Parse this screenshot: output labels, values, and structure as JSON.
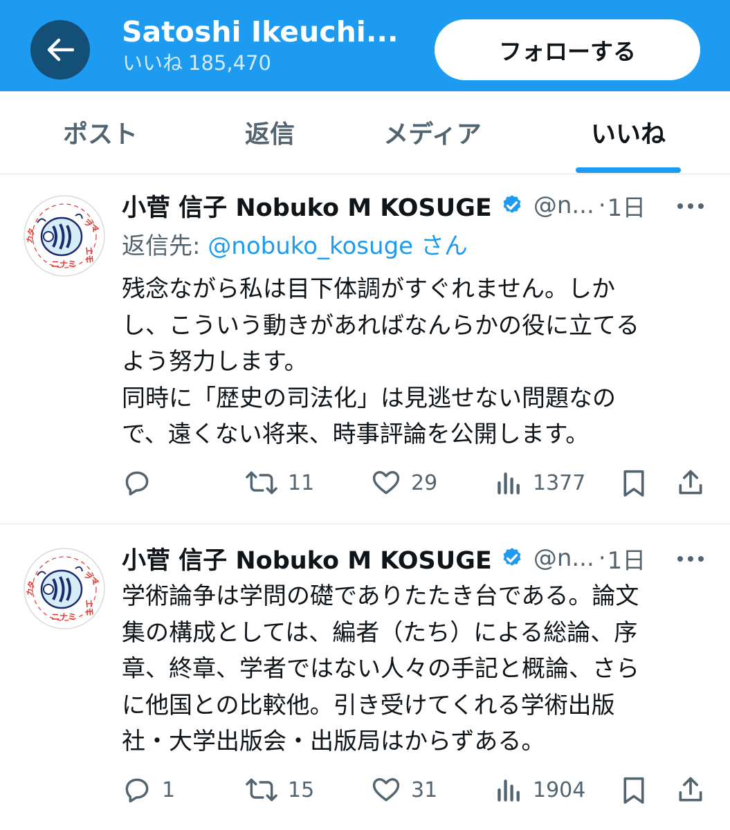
{
  "header": {
    "title": "Satoshi Ikeuchi...",
    "subtitle_label": "いいね",
    "subtitle_count": "185,470",
    "follow_label": "フォローする"
  },
  "tabs": [
    {
      "label": "ポスト",
      "active": false
    },
    {
      "label": "返信",
      "active": false
    },
    {
      "label": "メディア",
      "active": false
    },
    {
      "label": "いいね",
      "active": true
    }
  ],
  "tweets": [
    {
      "display_name": "小菅 信子 Nobuko M KOSUGE",
      "handle": "@n...",
      "separator": "·",
      "time": "1日",
      "reply_prefix": "返信先: ",
      "reply_mention": "@nobuko_kosuge",
      "reply_suffix": " さん",
      "text_lines": [
        "残念ながら私は目下体調がすぐれません。しか",
        "し、こういう動きがあればなんらかの役に立てる",
        "よう努力します。",
        "同時に「歴史の司法化」は見逃せない問題なの",
        "で、遠くない将来、時事評論を公開します。"
      ],
      "replies": "",
      "retweets": "11",
      "likes": "29",
      "views": "1377"
    },
    {
      "display_name": "小菅 信子 Nobuko M KOSUGE",
      "handle": "@n...",
      "separator": "·",
      "time": "1日",
      "text_lines": [
        "学術論争は学問の礎でありたたき台である。論文",
        "集の構成としては、編者（たち）による総論、序",
        "章、終章、学者ではない人々の手記と概論、さら",
        "に他国との比較他。引き受けてくれる学術出版",
        "社・大学出版会・出版局はからずある。"
      ],
      "replies": "1",
      "retweets": "15",
      "likes": "31",
      "views": "1904"
    }
  ],
  "colors": {
    "header_bg": "#1d9bf0",
    "back_button_bg": "#144f78",
    "accent": "#1d9bf0",
    "secondary_text": "#536471",
    "primary_text": "#0f1419"
  },
  "icons": {
    "back": "arrow-left-icon",
    "verified": "verified-badge-icon",
    "more": "more-horizontal-icon",
    "reply": "reply-icon",
    "retweet": "retweet-icon",
    "like": "heart-icon",
    "views": "views-icon",
    "bookmark": "bookmark-icon",
    "share": "share-icon"
  }
}
